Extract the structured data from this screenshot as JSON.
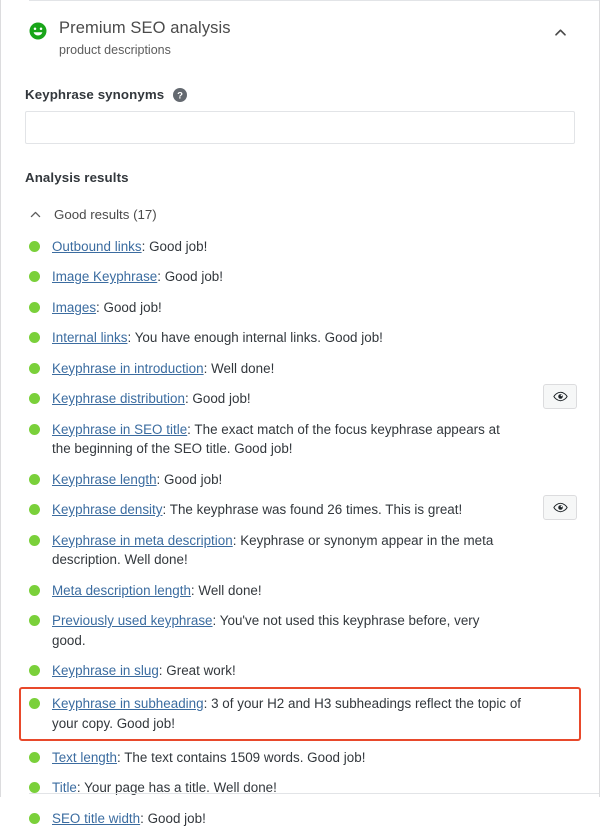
{
  "panel": {
    "score_icon": "green-smiley-icon",
    "title": "Premium SEO analysis",
    "subtitle": "product descriptions",
    "collapse_icon": "chevron-up-icon"
  },
  "synonyms": {
    "label": "Keyphrase synonyms",
    "help_icon": "help-circle-icon",
    "value": "",
    "placeholder": ""
  },
  "analysis": {
    "heading": "Analysis results",
    "group": {
      "chevron_icon": "chevron-up-icon",
      "label": "Good results (17)"
    },
    "items": [
      {
        "bullet": "good",
        "link": "Outbound links",
        "text": ": Good job!",
        "eye": false,
        "highlighted": false
      },
      {
        "bullet": "good",
        "link": "Image Keyphrase",
        "text": ": Good job!",
        "eye": false,
        "highlighted": false
      },
      {
        "bullet": "good",
        "link": "Images",
        "text": ": Good job!",
        "eye": false,
        "highlighted": false
      },
      {
        "bullet": "good",
        "link": "Internal links",
        "text": ": You have enough internal links. Good job!",
        "eye": false,
        "highlighted": false
      },
      {
        "bullet": "good",
        "link": "Keyphrase in introduction",
        "text": ": Well done!",
        "eye": false,
        "highlighted": false
      },
      {
        "bullet": "good",
        "link": "Keyphrase distribution",
        "text": ": Good job!",
        "eye": true,
        "highlighted": false
      },
      {
        "bullet": "good",
        "link": "Keyphrase in SEO title",
        "text": ": The exact match of the focus keyphrase appears at the beginning of the SEO title. Good job!",
        "eye": false,
        "highlighted": false
      },
      {
        "bullet": "good",
        "link": "Keyphrase length",
        "text": ": Good job!",
        "eye": false,
        "highlighted": false
      },
      {
        "bullet": "good",
        "link": "Keyphrase density",
        "text": ": The keyphrase was found 26 times. This is great!",
        "eye": true,
        "highlighted": false
      },
      {
        "bullet": "good",
        "link": "Keyphrase in meta description",
        "text": ": Keyphrase or synonym appear in the meta description. Well done!",
        "eye": false,
        "highlighted": false
      },
      {
        "bullet": "good",
        "link": "Meta description length",
        "text": ": Well done!",
        "eye": false,
        "highlighted": false
      },
      {
        "bullet": "good",
        "link": "Previously used keyphrase",
        "text": ": You've not used this keyphrase before, very good.",
        "eye": false,
        "highlighted": false
      },
      {
        "bullet": "good",
        "link": "Keyphrase in slug",
        "text": ": Great work!",
        "eye": false,
        "highlighted": false
      },
      {
        "bullet": "good",
        "link": "Keyphrase in subheading",
        "text": ": 3 of your H2 and H3 subheadings reflect the topic of your copy. Good job!",
        "eye": false,
        "highlighted": true
      },
      {
        "bullet": "good",
        "link": "Text length",
        "text": ": The text contains 1509 words. Good job!",
        "eye": false,
        "highlighted": false
      },
      {
        "bullet": "good",
        "link": "Title",
        "text": ": Your page has a title. Well done!",
        "eye": false,
        "highlighted": false
      },
      {
        "bullet": "good",
        "link": "SEO title width",
        "text": ": Good job!",
        "eye": false,
        "highlighted": false
      }
    ],
    "eye_icon": "eye-icon"
  },
  "colors": {
    "good": "#7ad03a",
    "link": "#3b6ca0",
    "highlight_border": "#e8492b",
    "text": "#32373c",
    "border": "#e2e4e7"
  }
}
